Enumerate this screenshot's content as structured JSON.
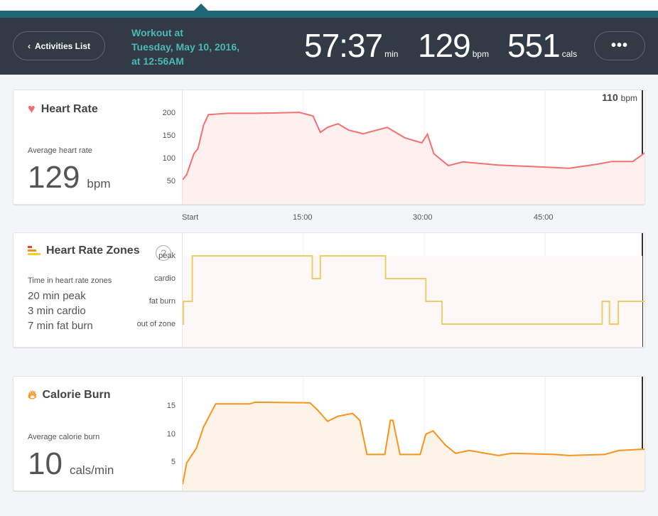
{
  "header": {
    "back_label": "Activities List",
    "title_lines": [
      "Workout at",
      "Tuesday, May 10, 2016,",
      "at 12:56AM"
    ],
    "duration": "57:37",
    "duration_unit": "min",
    "hr": "129",
    "hr_unit": "bpm",
    "cals": "551",
    "cals_unit": "cals",
    "more_label": "•••"
  },
  "heart_rate": {
    "title": "Heart Rate",
    "avg_label": "Average heart rate",
    "avg_value": "129",
    "avg_unit": "bpm",
    "cursor_value": "110",
    "cursor_unit": "bpm",
    "color": "#f2706f"
  },
  "zones": {
    "title": "Heart Rate Zones",
    "help": "?",
    "label": "Time in heart rate zones",
    "lines": [
      "20 min peak",
      "3 min cardio",
      "7 min fat burn"
    ],
    "levels": [
      "peak",
      "cardio",
      "fat burn",
      "out of zone"
    ],
    "color": "#e8cf6a"
  },
  "calories": {
    "title": "Calorie Burn",
    "avg_label": "Average calorie burn",
    "avg_value": "10",
    "avg_unit": "cals/min",
    "color": "#f7941d"
  },
  "x_axis": {
    "ticks": [
      "Start",
      "15:00",
      "30:00",
      "45:00"
    ]
  },
  "chart_data": [
    {
      "type": "area",
      "ylim": [
        0,
        220
      ],
      "yticks": [
        50,
        100,
        150,
        200
      ],
      "xlim": [
        0,
        57.4
      ],
      "x": [
        0,
        0.5,
        1.4,
        1.9,
        2.6,
        3.2,
        5.6,
        9.2,
        14.5,
        16.2,
        17.1,
        18,
        19.3,
        20.6,
        22.4,
        25.4,
        27.6,
        29.7,
        30.4,
        31.2,
        33,
        34.8,
        39.2,
        44.5,
        48,
        51.5,
        53.3,
        55.9,
        57.4
      ],
      "y": [
        55,
        66,
        112,
        123,
        175,
        198,
        201,
        201,
        203,
        195,
        159,
        170,
        178,
        164,
        156,
        170,
        147,
        136,
        155,
        112,
        86,
        94,
        87,
        83,
        80,
        89,
        95,
        95,
        114
      ]
    },
    {
      "type": "line",
      "step": true,
      "levels": [
        "out of zone",
        "fat burn",
        "cardio",
        "peak"
      ],
      "segments": [
        [
          0,
          0.1,
          "out of zone"
        ],
        [
          0.1,
          1.2,
          "fat burn"
        ],
        [
          1.2,
          16.1,
          "peak"
        ],
        [
          16.1,
          17.1,
          "cardio"
        ],
        [
          17.1,
          25.2,
          "peak"
        ],
        [
          25.2,
          30.2,
          "cardio"
        ],
        [
          30.2,
          32.2,
          "fat burn"
        ],
        [
          32.2,
          52.1,
          "out of zone"
        ],
        [
          52.1,
          53,
          "fat burn"
        ],
        [
          53,
          54.1,
          "out of zone"
        ],
        [
          54.1,
          57.4,
          "fat burn"
        ]
      ]
    },
    {
      "type": "area",
      "ylim": [
        0,
        17.5
      ],
      "yticks": [
        5,
        10,
        15
      ],
      "xlim": [
        0,
        57.4
      ],
      "x": [
        0,
        0.5,
        1.7,
        2.6,
        4.1,
        8.3,
        9,
        15.8,
        16.7,
        18,
        19.3,
        21.1,
        22,
        22.9,
        25.1,
        25.8,
        26.1,
        27,
        29.5,
        30.2,
        31.1,
        32.6,
        33.9,
        35.6,
        39.2,
        40.9,
        46.2,
        48,
        52.4,
        54.2,
        56.8,
        57.4
      ],
      "y": [
        1.3,
        5.1,
        7.7,
        11.5,
        15.6,
        15.6,
        15.9,
        15.8,
        14.6,
        12.5,
        13.4,
        13.9,
        12.7,
        6.6,
        6.6,
        12.7,
        12.7,
        6.6,
        6.6,
        10.2,
        10.8,
        8.3,
        6.8,
        7.3,
        6.4,
        6.8,
        6.6,
        6.4,
        6.6,
        7.3,
        7.5,
        7.5
      ]
    }
  ]
}
